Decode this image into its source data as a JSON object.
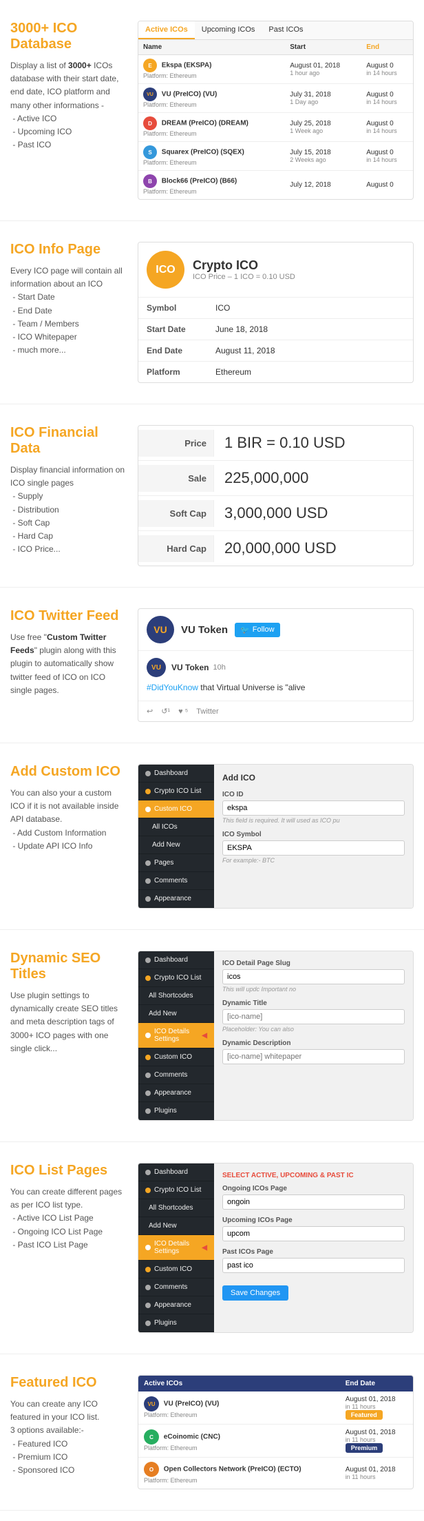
{
  "sections": [
    {
      "id": "ico-database",
      "title": "3000+ ICO Database",
      "desc_parts": [
        "Display a list of ",
        "3000+",
        " ICOs database with their start date, end date, ICO platform and many other informations -\n - Active ICO\n - Upcoming ICO\n - Past ICO"
      ]
    },
    {
      "id": "ico-info",
      "title": "ICO Info Page",
      "desc": "Every ICO page will contain all information about an ICO\n - Start Date\n - End Date\n - Team / Members\n - ICO Whitepaper\n - much more..."
    },
    {
      "id": "ico-financial",
      "title": "ICO Financial Data",
      "desc": "Display financial information on ICO single pages\n - Supply\n - Distribution\n - Soft Cap\n - Hard Cap\n - ICO Price..."
    },
    {
      "id": "ico-twitter",
      "title": "ICO Twitter Feed",
      "desc_parts": [
        "Use free \"",
        "Custom Twitter Feeds",
        "\" plugin along with this plugin to automatically show twitter feed of ICO on ICO single pages."
      ]
    },
    {
      "id": "add-custom-ico",
      "title": "Add Custom ICO",
      "desc": "You can also your a custom ICO if it is not available inside API database.\n - Add Custom Information\n - Update API ICO Info"
    },
    {
      "id": "dynamic-seo",
      "title": "Dynamic SEO Titles",
      "desc": "Use plugin settings to dynamically create SEO titles and meta description tags of 3000+ ICO pages with one single click..."
    },
    {
      "id": "list-pages",
      "title": "ICO List Pages",
      "desc": "You can create different pages as per ICO list type.\n - Active ICO List Page\n - Ongoing ICO List Page\n - Past ICO List Page"
    },
    {
      "id": "featured-ico",
      "title": "Featured ICO",
      "desc": "You can create any ICO featured in your ICO list.\n3 options available:-\n - Featured ICO\n - Premium ICO\n - Sponsored ICO"
    }
  ],
  "table": {
    "tabs": [
      "Active ICOs",
      "Upcoming ICOs",
      "Past ICOs"
    ],
    "active_tab": "Active ICOs",
    "headers": [
      "Name",
      "Start",
      "End"
    ],
    "rows": [
      {
        "logo_class": "logo-ekspa",
        "logo_text": "E",
        "name": "Ekspa (EKSPA)",
        "platform": "Platform: Ethereum",
        "start": "August 01, 2018",
        "start_ago": "1 hour ago",
        "end": "August 0",
        "end_ago": "in 14 hours"
      },
      {
        "logo_class": "logo-vu",
        "logo_text": "VU",
        "name": "VU (PreICO) (VU)",
        "platform": "Platform: Ethereum",
        "start": "July 31, 2018",
        "start_ago": "1 Day ago",
        "end": "August 0",
        "end_ago": "in 14 hours"
      },
      {
        "logo_class": "logo-dream",
        "logo_text": "D",
        "name": "DREAM (PreICO) (DREAM)",
        "platform": "Platform: Ethereum",
        "start": "July 25, 2018",
        "start_ago": "1 Week ago",
        "end": "August 0",
        "end_ago": "in 14 hours"
      },
      {
        "logo_class": "logo-sqex",
        "logo_text": "S",
        "name": "Squarex (PreICO) (SQEX)",
        "platform": "Platform: Ethereum",
        "start": "July 15, 2018",
        "start_ago": "2 Weeks ago",
        "end": "August 0",
        "end_ago": "in 14 hours"
      },
      {
        "logo_class": "logo-b66",
        "logo_text": "B",
        "name": "Block66 (PreICO) (B66)",
        "platform": "Platform: Ethereum",
        "start": "July 12, 2018",
        "start_ago": "",
        "end": "August 0",
        "end_ago": ""
      }
    ]
  },
  "ico_info": {
    "icon_text": "ICO",
    "title": "Crypto ICO",
    "price_label": "ICO Price – 1 ICO = 0.10 USD",
    "fields": [
      {
        "label": "Symbol",
        "value": "ICO"
      },
      {
        "label": "Start Date",
        "value": "June 18, 2018"
      },
      {
        "label": "End Date",
        "value": "August 11, 2018"
      },
      {
        "label": "Platform",
        "value": "Ethereum"
      }
    ]
  },
  "financial": {
    "rows": [
      {
        "label": "Price",
        "value": "1 BIR = 0.10 USD"
      },
      {
        "label": "Sale",
        "value": "225,000,000"
      },
      {
        "label": "Soft Cap",
        "value": "3,000,000 USD"
      },
      {
        "label": "Hard Cap",
        "value": "20,000,000 USD"
      }
    ]
  },
  "twitter": {
    "logo_text": "VU",
    "name": "VU Token",
    "follow_label": "Follow",
    "post": {
      "logo_text": "VU",
      "name": "VU Token",
      "time": "10h",
      "text_parts": [
        "#DidYouKnow",
        " that Virtual Universe is \"alive"
      ],
      "actions": [
        {
          "icon": "↩",
          "count": ""
        },
        {
          "icon": "↺",
          "count": "1"
        },
        {
          "icon": "♥",
          "count": "5"
        },
        {
          "icon": "",
          "label": "Twitter"
        }
      ]
    }
  },
  "custom_ico": {
    "sidebar": [
      {
        "label": "Dashboard",
        "active": false,
        "dot": "grey"
      },
      {
        "label": "Crypto ICO List",
        "active": false,
        "dot": "yellow"
      },
      {
        "label": "Custom ICO",
        "active": true,
        "dot": "yellow"
      },
      {
        "label": "All ICOs",
        "active": false,
        "dot": ""
      },
      {
        "label": "Add New",
        "active": false,
        "dot": ""
      },
      {
        "label": "Pages",
        "active": false,
        "dot": "grey"
      },
      {
        "label": "Comments",
        "active": false,
        "dot": "grey"
      },
      {
        "label": "Appearance",
        "active": false,
        "dot": "grey"
      }
    ],
    "content_title": "Add ICO",
    "fields": [
      {
        "label": "ICO ID",
        "value": "ekspa",
        "hint": "This field is required. It will used as ICO pu"
      },
      {
        "label": "ICO Symbol",
        "value": "EKSPA",
        "hint": "For example:- BTC"
      }
    ]
  },
  "seo": {
    "sidebar": [
      {
        "label": "Dashboard",
        "active": false,
        "dot": "grey"
      },
      {
        "label": "Crypto ICO List",
        "active": false,
        "dot": "yellow"
      },
      {
        "label": "All Shortcodes",
        "active": false,
        "dot": ""
      },
      {
        "label": "Add New",
        "active": false,
        "dot": ""
      },
      {
        "label": "ICO Details Settings",
        "active": true,
        "dot": "yellow"
      },
      {
        "label": "Custom ICO",
        "active": false,
        "dot": "yellow"
      },
      {
        "label": "Comments",
        "active": false,
        "dot": "grey"
      },
      {
        "label": "Appearance",
        "active": false,
        "dot": "grey"
      },
      {
        "label": "Plugins",
        "active": false,
        "dot": "grey"
      }
    ],
    "fields": [
      {
        "label": "ICO Detail Page Slug",
        "value": "icos",
        "hint": "This will updc Important no"
      },
      {
        "label": "Dynamic Title",
        "value": "",
        "placeholder": "[ico-name]",
        "hint": "Placeholder: You can also"
      },
      {
        "label": "Dynamic Description",
        "value": "",
        "placeholder": "[ico-name] whitepaper",
        "hint": ""
      }
    ]
  },
  "list_pages": {
    "sidebar": [
      {
        "label": "Dashboard",
        "active": false,
        "dot": "grey"
      },
      {
        "label": "Crypto ICO List",
        "active": false,
        "dot": "yellow"
      },
      {
        "label": "All Shortcodes",
        "active": false,
        "dot": ""
      },
      {
        "label": "Add New",
        "active": false,
        "dot": ""
      },
      {
        "label": "ICO Details Settings",
        "active": true,
        "dot": "yellow"
      },
      {
        "label": "Custom ICO",
        "active": false,
        "dot": "yellow"
      },
      {
        "label": "Comments",
        "active": false,
        "dot": "grey"
      },
      {
        "label": "Appearance",
        "active": false,
        "dot": "grey"
      },
      {
        "label": "Plugins",
        "active": false,
        "dot": "grey"
      }
    ],
    "select_label": "SELECT ACTIVE, UPCOMING & PAST IC",
    "fields": [
      {
        "label": "Ongoing ICOs Page",
        "value": "ongoin"
      },
      {
        "label": "Upcoming ICOs Page",
        "value": "upcom"
      },
      {
        "label": "Past ICOs Page",
        "value": "past ico"
      }
    ],
    "save_btn": "Save Changes"
  },
  "featured": {
    "tabs": [
      "Active ICOs",
      "End Date"
    ],
    "rows": [
      {
        "logo_class": "logo-vu",
        "logo_text": "VU",
        "name": "VU (PreICO) (VU)",
        "platform": "Platform: Ethereum",
        "end_date": "August 01, 2018",
        "end_ago": "in 11 hours",
        "badge": "Featured",
        "badge_class": "featured"
      },
      {
        "logo_class": "logo-cnc",
        "logo_text": "C",
        "name": "eCoinomic (CNC)",
        "platform": "Platform: Ethereum",
        "end_date": "August 01, 2018",
        "end_ago": "in 11 hours",
        "badge": "Premium",
        "badge_class": "premium"
      },
      {
        "logo_class": "logo-ecto",
        "logo_text": "O",
        "name": "Open Collectors Network (PreICO) (ECTO)",
        "platform": "Platform: Ethereum",
        "end_date": "August 01, 2018",
        "end_ago": "in 11 hours",
        "badge": "",
        "badge_class": ""
      }
    ]
  }
}
